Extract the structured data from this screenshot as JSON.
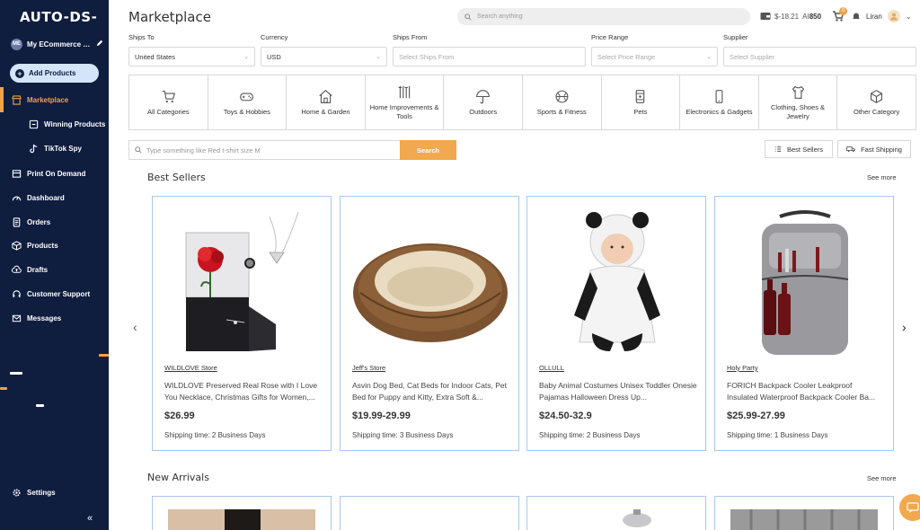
{
  "app": {
    "logo": "AUTO-DS-",
    "page_title": "Marketplace"
  },
  "sidebar": {
    "store_badge": "ME",
    "store_name": "My ECommerce St...",
    "add_products": "Add Products",
    "items": [
      {
        "label": "Marketplace",
        "icon": "storefront-icon"
      },
      {
        "label": "Winning Products",
        "icon": "trophy-icon"
      },
      {
        "label": "TikTok Spy",
        "icon": "tiktok-icon"
      },
      {
        "label": "Print On Demand",
        "icon": "print-icon"
      },
      {
        "label": "Dashboard",
        "icon": "gauge-icon"
      },
      {
        "label": "Orders",
        "icon": "orders-icon"
      },
      {
        "label": "Products",
        "icon": "box-icon"
      },
      {
        "label": "Drafts",
        "icon": "cloud-upload-icon"
      },
      {
        "label": "Customer Support",
        "icon": "support-icon"
      },
      {
        "label": "Messages",
        "icon": "mail-icon"
      }
    ],
    "settings": "Settings",
    "collapse": "«",
    "accent": "#f0a24a"
  },
  "topbar": {
    "search_placeholder": "Search anything",
    "balance_prefix": "$-18.21",
    "balance_ai": "AI",
    "balance_credits": "850",
    "cart_count": "0",
    "user_name": "Liran"
  },
  "filters": {
    "ships_to": {
      "label": "Ships To",
      "value": "United States"
    },
    "currency": {
      "label": "Currency",
      "value": "USD"
    },
    "ships_from": {
      "label": "Ships From",
      "placeholder": "Select Ships From"
    },
    "price_range": {
      "label": "Price Range",
      "placeholder": "Select Price Range"
    },
    "supplier": {
      "label": "Supplier",
      "placeholder": "Select Supplier"
    }
  },
  "categories": [
    {
      "label": "All Categories",
      "icon": "cart-icon"
    },
    {
      "label": "Toys & Hobbies",
      "icon": "gamepad-icon"
    },
    {
      "label": "Home & Garden",
      "icon": "house-icon"
    },
    {
      "label": "Home Improvements & Tools",
      "icon": "tools-icon"
    },
    {
      "label": "Outdoors",
      "icon": "umbrella-icon"
    },
    {
      "label": "Sports & Fitness",
      "icon": "ball-icon"
    },
    {
      "label": "Pets",
      "icon": "pet-food-icon"
    },
    {
      "label": "Electronics & Gadgets",
      "icon": "phone-icon"
    },
    {
      "label": "Clothing, Shoes & Jewelry",
      "icon": "shirt-icon"
    },
    {
      "label": "Other Category",
      "icon": "cube-icon"
    }
  ],
  "product_search": {
    "placeholder": "Type something like Red t-shirt size M",
    "button": "Search",
    "best_sellers": "Best Sellers",
    "fast_shipping": "Fast Shipping"
  },
  "best_sellers": {
    "title": "Best Sellers",
    "see_more": "See more",
    "products": [
      {
        "store": "WILDLOVE Store",
        "name": "WILDLOVE Preserved Real Rose with I Love You Necklace, Christmas Gifts for Women,...",
        "price": "$26.99",
        "shipping": "Shipping time: 2 Business Days"
      },
      {
        "store": "Jeff's Store",
        "name": "Asvin Dog Bed, Cat Beds for Indoor Cats, Pet Bed for Puppy and Kitty, Extra Soft &...",
        "price": "$19.99-29.99",
        "shipping": "Shipping time: 3 Business Days"
      },
      {
        "store": "OLLULL",
        "name": "Baby Animal Costumes Unisex Toddler Onesie Pajamas Halloween Dress Up...",
        "price": "$24.50-32.9",
        "shipping": "Shipping time: 2 Business Days"
      },
      {
        "store": "Holy Party",
        "name": "FORICH Backpack Cooler Leakproof Insulated Waterproof Backpack Cooler Ba...",
        "price": "$25.99-27.99",
        "shipping": "Shipping time: 1 Business Days"
      }
    ]
  },
  "new_arrivals": {
    "title": "New Arrivals",
    "see_more": "See more"
  }
}
